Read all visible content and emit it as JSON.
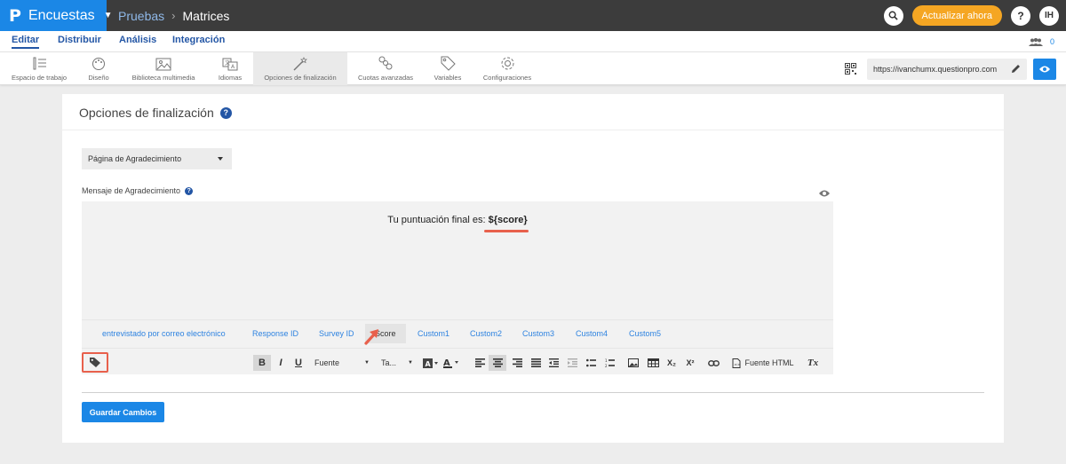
{
  "app": {
    "logo": "P",
    "name": "Encuestas"
  },
  "breadcrumb": {
    "parent": "Pruebas",
    "current": "Matrices"
  },
  "header": {
    "upgrade_label": "Actualizar ahora",
    "help_label": "?",
    "avatar_initials": "IH"
  },
  "nav_tabs": [
    {
      "label": "Editar",
      "active": true
    },
    {
      "label": "Distribuir",
      "active": false
    },
    {
      "label": "Análisis",
      "active": false
    },
    {
      "label": "Integración",
      "active": false
    }
  ],
  "collaborators_count": "0",
  "toolbar": {
    "items": [
      {
        "label": "Espacio de trabajo",
        "icon": "workspace-icon"
      },
      {
        "label": "Diseño",
        "icon": "palette-icon"
      },
      {
        "label": "Biblioteca multimedia",
        "icon": "image-icon"
      },
      {
        "label": "Idiomas",
        "icon": "translate-icon"
      },
      {
        "label": "Opciones de finalización",
        "icon": "magic-wand-icon",
        "active": true
      },
      {
        "label": "Cuotas avanzadas",
        "icon": "quota-icon"
      },
      {
        "label": "Variables",
        "icon": "tag-icon"
      },
      {
        "label": "Configuraciones",
        "icon": "gear-icon"
      }
    ],
    "survey_url": "https://ivanchumx.questionpro.com"
  },
  "panel": {
    "title": "Opciones de finalización",
    "page_select_value": "Página de Agradecimiento",
    "message_label": "Mensaje de Agradecimiento",
    "editor_text_prefix": "Tu puntuación final es: ",
    "editor_text_variable": "${score}",
    "tags": [
      "entrevistado por correo electrónico",
      "Response ID",
      "Survey ID",
      "Score",
      "Custom1",
      "Custom2",
      "Custom3",
      "Custom4",
      "Custom5"
    ],
    "active_tag": "Score",
    "format": {
      "bold": "B",
      "italic": "I",
      "underline": "U",
      "font_label": "Fuente",
      "size_label": "Ta...",
      "subscript": "X₂",
      "superscript": "X²",
      "source_label": "Fuente HTML",
      "clear_format": "Tx"
    },
    "save_label": "Guardar Cambios"
  },
  "colors": {
    "brand_blue": "#1b87e6",
    "topbar": "#3c3c3c",
    "upgrade": "#f5a623",
    "highlight_red": "#e8604c",
    "link_blue": "#2356a5"
  }
}
